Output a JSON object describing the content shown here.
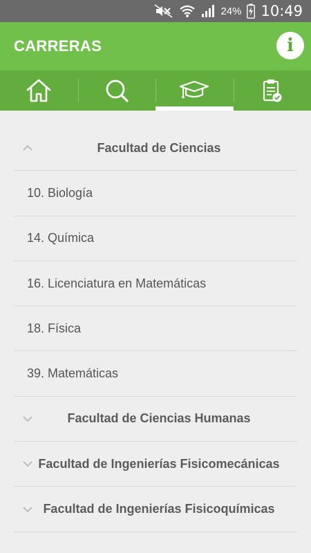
{
  "status_bar": {
    "battery_percent": "24%",
    "time": "10:49",
    "icons": [
      "mute-icon",
      "wifi-icon",
      "signal-icon",
      "battery-charging-icon"
    ]
  },
  "app_bar": {
    "title": "CARRERAS",
    "info_icon": "info-icon",
    "info_glyph": "i"
  },
  "tabs": [
    {
      "name": "home",
      "icon": "home-icon",
      "active": false
    },
    {
      "name": "search",
      "icon": "search-icon",
      "active": false
    },
    {
      "name": "careers",
      "icon": "graduation-cap-icon",
      "active": true
    },
    {
      "name": "checklist",
      "icon": "clipboard-check-icon",
      "active": false
    }
  ],
  "faculties": [
    {
      "title": "Facultad de Ciencias",
      "expanded": true,
      "careers": [
        {
          "label": "10. Biología"
        },
        {
          "label": "14. Química"
        },
        {
          "label": "16. Licenciatura en Matemáticas"
        },
        {
          "label": "18. Física"
        },
        {
          "label": "39. Matemáticas"
        }
      ]
    },
    {
      "title": "Facultad de Ciencias Humanas",
      "expanded": false
    },
    {
      "title": "Facultad de Ingenierías Fisicomecánicas",
      "expanded": false
    },
    {
      "title": "Facultad de Ingenierías Fisicoquímicas",
      "expanded": false
    }
  ],
  "colors": {
    "primary": "#71c04c",
    "tab_bar": "#63ad3e",
    "status_bar": "#6a6a6a",
    "background": "#eeeeee",
    "text": "#555555"
  }
}
